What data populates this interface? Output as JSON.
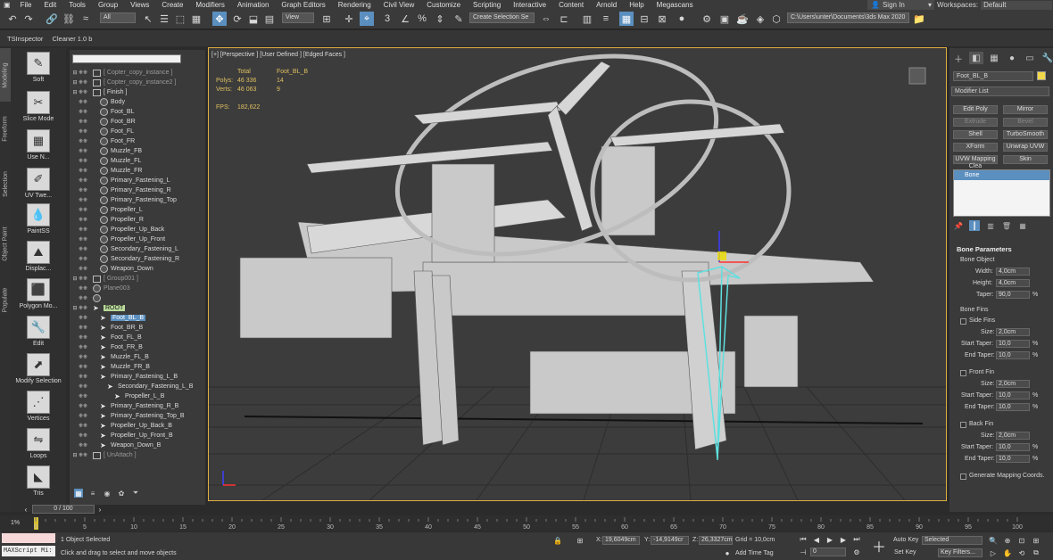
{
  "menu": [
    "File",
    "Edit",
    "Tools",
    "Group",
    "Views",
    "Create",
    "Modifiers",
    "Animation",
    "Graph Editors",
    "Rendering",
    "Civil View",
    "Customize",
    "Scripting",
    "Interactive",
    "Content",
    "Arnold",
    "Help",
    "Megascans"
  ],
  "signin": "Sign In",
  "workspaces_label": "Workspaces:",
  "workspaces_value": "Default",
  "toolbar": {
    "filter": "All",
    "refcoord": "View",
    "selection_set": "Create Selection Se",
    "path": "C:\\Users\\unter\\Documents\\3ds Max 2020"
  },
  "ribbon2": [
    "TSInspector",
    "Cleaner 1.0 b"
  ],
  "vtabs": [
    "Modeling",
    "Freeform",
    "Selection",
    "Object Paint",
    "Populate"
  ],
  "tools": [
    {
      "label": "Soft",
      "icon": "soft-selection-icon"
    },
    {
      "label": "Slice Mode",
      "icon": "slice-icon"
    },
    {
      "label": "Use N...",
      "icon": "grid-icon"
    },
    {
      "label": "UV Twe...",
      "icon": "uv-tweak-icon"
    },
    {
      "label": "PaintSS",
      "icon": "paint-drop-icon"
    },
    {
      "label": "Displac...",
      "icon": "displace-icon"
    },
    {
      "label": "Polygon Mo...",
      "icon": "cube-icon"
    },
    {
      "label": "Edit",
      "icon": "edit-icon"
    },
    {
      "label": "Modify Selection",
      "icon": "modify-selection-icon"
    },
    {
      "label": "Vertices",
      "icon": "vertices-icon"
    },
    {
      "label": "Loops",
      "icon": "loops-icon"
    },
    {
      "label": "Tris",
      "icon": "tris-icon"
    }
  ],
  "scene_tree": [
    {
      "label": "[ Copter_copy_instance ]",
      "type": "group",
      "indent": 0,
      "style": "dim"
    },
    {
      "label": "[ Copter_copy_instance2 ]",
      "type": "group",
      "indent": 0,
      "style": "dim"
    },
    {
      "label": "[ Finish ]",
      "type": "group",
      "indent": 0,
      "style": ""
    },
    {
      "label": "Body",
      "type": "obj",
      "indent": 1,
      "style": ""
    },
    {
      "label": "Foot_BL",
      "type": "obj",
      "indent": 1,
      "style": ""
    },
    {
      "label": "Foot_BR",
      "type": "obj",
      "indent": 1,
      "style": ""
    },
    {
      "label": "Foot_FL",
      "type": "obj",
      "indent": 1,
      "style": ""
    },
    {
      "label": "Foot_FR",
      "type": "obj",
      "indent": 1,
      "style": ""
    },
    {
      "label": "Muzzle_FB",
      "type": "obj",
      "indent": 1,
      "style": ""
    },
    {
      "label": "Muzzle_FL",
      "type": "obj",
      "indent": 1,
      "style": ""
    },
    {
      "label": "Muzzle_FR",
      "type": "obj",
      "indent": 1,
      "style": ""
    },
    {
      "label": "Primary_Fastening_L",
      "type": "obj",
      "indent": 1,
      "style": ""
    },
    {
      "label": "Primary_Fastening_R",
      "type": "obj",
      "indent": 1,
      "style": ""
    },
    {
      "label": "Primary_Fastening_Top",
      "type": "obj",
      "indent": 1,
      "style": ""
    },
    {
      "label": "Propeller_L",
      "type": "obj",
      "indent": 1,
      "style": ""
    },
    {
      "label": "Propeller_R",
      "type": "obj",
      "indent": 1,
      "style": ""
    },
    {
      "label": "Propeller_Up_Back",
      "type": "obj",
      "indent": 1,
      "style": ""
    },
    {
      "label": "Propeller_Up_Front",
      "type": "obj",
      "indent": 1,
      "style": ""
    },
    {
      "label": "Secondary_Fastening_L",
      "type": "obj",
      "indent": 1,
      "style": ""
    },
    {
      "label": "Secondary_Fastening_R",
      "type": "obj",
      "indent": 1,
      "style": ""
    },
    {
      "label": "Weapon_Down",
      "type": "obj",
      "indent": 1,
      "style": ""
    },
    {
      "label": "[ Group001 ]",
      "type": "group",
      "indent": 0,
      "style": "dim"
    },
    {
      "label": "Plane003",
      "type": "obj",
      "indent": 0,
      "style": "dim"
    },
    {
      "label": "",
      "type": "obj",
      "indent": 0,
      "style": ""
    },
    {
      "label": "ROOT",
      "type": "bone",
      "indent": 0,
      "style": "root"
    },
    {
      "label": "Foot_BL_B",
      "type": "bone",
      "indent": 1,
      "style": "hl"
    },
    {
      "label": "Foot_BR_B",
      "type": "bone",
      "indent": 1,
      "style": ""
    },
    {
      "label": "Foot_FL_B",
      "type": "bone",
      "indent": 1,
      "style": ""
    },
    {
      "label": "Foot_FR_B",
      "type": "bone",
      "indent": 1,
      "style": ""
    },
    {
      "label": "Muzzle_FL_B",
      "type": "bone",
      "indent": 1,
      "style": ""
    },
    {
      "label": "Muzzle_FR_B",
      "type": "bone",
      "indent": 1,
      "style": ""
    },
    {
      "label": "Primary_Fastening_L_B",
      "type": "bone",
      "indent": 1,
      "style": ""
    },
    {
      "label": "Secondary_Fastening_L_B",
      "type": "bone",
      "indent": 2,
      "style": ""
    },
    {
      "label": "Propeller_L_B",
      "type": "bone",
      "indent": 3,
      "style": ""
    },
    {
      "label": "Primary_Fastening_R_B",
      "type": "bone",
      "indent": 1,
      "style": ""
    },
    {
      "label": "Primary_Fastening_Top_B",
      "type": "bone",
      "indent": 1,
      "style": ""
    },
    {
      "label": "Propeller_Up_Back_B",
      "type": "bone",
      "indent": 1,
      "style": ""
    },
    {
      "label": "Propeller_Up_Front_B",
      "type": "bone",
      "indent": 1,
      "style": ""
    },
    {
      "label": "Weapon_Down_B",
      "type": "bone",
      "indent": 1,
      "style": ""
    },
    {
      "label": "[ UnAttach ]",
      "type": "group",
      "indent": 0,
      "style": "dim"
    }
  ],
  "viewport": {
    "label": "[+] [Perspective ] [User Defined ] [Edged Faces ]",
    "stats_total": "Total",
    "stats_obj": "Foot_BL_B",
    "polys_label": "Polys:",
    "polys_total": "46 336",
    "polys_obj": "14",
    "verts_label": "Verts:",
    "verts_total": "46 063",
    "verts_obj": "9",
    "fps_label": "FPS:",
    "fps_value": "182,622"
  },
  "cmd": {
    "object_name": "Foot_BL_B",
    "swatch_color": "#f2d84a",
    "modifier_list": "Modifier List",
    "buttons": [
      {
        "label": "Edit Poly",
        "dis": false
      },
      {
        "label": "Mirror",
        "dis": false
      },
      {
        "label": "Extrude",
        "dis": true
      },
      {
        "label": "Bevel",
        "dis": true
      },
      {
        "label": "Shell",
        "dis": false
      },
      {
        "label": "TurboSmooth",
        "dis": false
      },
      {
        "label": "XForm",
        "dis": false
      },
      {
        "label": "Unwrap UVW",
        "dis": false
      },
      {
        "label": "UVW Mapping Clea",
        "dis": false
      },
      {
        "label": "Skin",
        "dis": false
      }
    ],
    "stack": [
      "Bone"
    ],
    "rollout_title": "Bone Parameters",
    "bone_object": "Bone Object",
    "width_label": "Width:",
    "width": "4,0cm",
    "height_label": "Height:",
    "height": "4,0cm",
    "taper_label": "Taper:",
    "taper": "90,0",
    "bone_fins": "Bone Fins",
    "side_fins": "Side Fins",
    "front_fin": "Front Fin",
    "back_fin": "Back Fin",
    "size_label": "Size:",
    "start_taper_label": "Start Taper:",
    "end_taper_label": "End Taper:",
    "size": "2,0cm",
    "start_taper": "10,0",
    "end_taper": "10,0",
    "pct": "%",
    "gen_mapping": "Generate Mapping Coords."
  },
  "time": {
    "slider": "0 / 100",
    "ticks": [
      "0",
      "5",
      "10",
      "15",
      "20",
      "25",
      "30",
      "35",
      "40",
      "45",
      "50",
      "55",
      "60",
      "65",
      "70",
      "75",
      "80",
      "85",
      "90",
      "95",
      "100"
    ],
    "pct": "1%"
  },
  "status": {
    "selected": "1 Object Selected",
    "prompt": "Click and drag to select and move objects",
    "maxscript": "MAXScript Mi:",
    "x_label": "X:",
    "x": "19,6049cm",
    "y_label": "Y:",
    "y": "-14,9149cr",
    "z_label": "Z:",
    "z": "26,3327cm",
    "grid": "Grid = 10,0cm",
    "add_time_tag": "Add Time Tag",
    "frame": "0",
    "auto_key": "Auto Key",
    "set_key": "Set Key",
    "selected_dd": "Selected",
    "key_filters": "Key Filters..."
  }
}
